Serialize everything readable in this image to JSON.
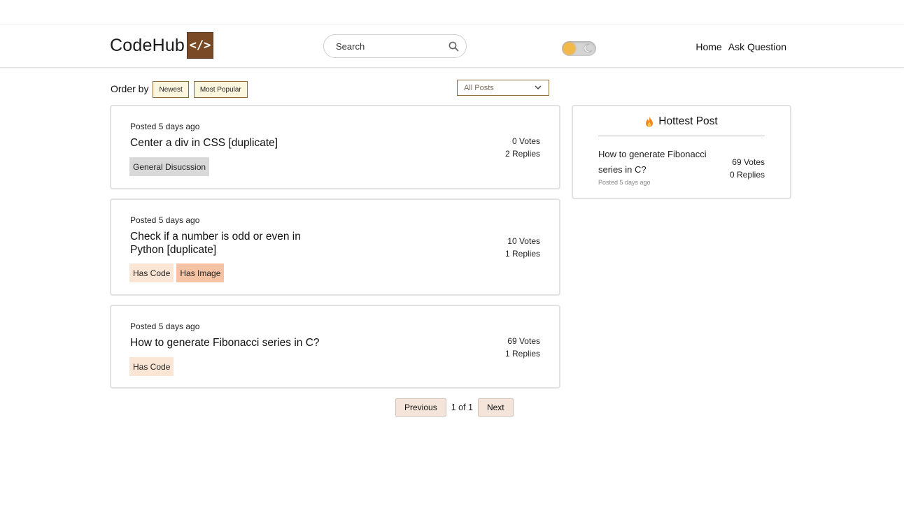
{
  "header": {
    "logo_text": "CodeHub",
    "logo_symbol": "</>",
    "search_placeholder": "Search",
    "nav": [
      "Home",
      "Ask Question"
    ],
    "accent": "#7a4a26"
  },
  "toolbar": {
    "order_label": "Order by",
    "order_options": [
      "Newest",
      "Most Popular"
    ],
    "filter_selected": "All Posts"
  },
  "posts": [
    {
      "posted": "Posted 5 days ago",
      "title": "Center a div in CSS [duplicate]",
      "votes": "0 Votes",
      "replies": "2 Replies",
      "tags": [
        "General Disucssion"
      ]
    },
    {
      "posted": "Posted 5 days ago",
      "title": "Check if a number is odd or even in Python [duplicate]",
      "votes": "10 Votes",
      "replies": "1 Replies",
      "tags": [
        "Has Code",
        "Has Image"
      ]
    },
    {
      "posted": "Posted 5 days ago",
      "title": "How to generate Fibonacci series in C?",
      "votes": "69 Votes",
      "replies": "1 Replies",
      "tags": [
        "Has Code"
      ]
    }
  ],
  "pagination": {
    "previous": "Previous",
    "info": "1 of 1",
    "next": "Next"
  },
  "hottest": {
    "heading": "Hottest Post",
    "title": "How to generate Fibonacci series in C?",
    "posted": "Posted 5 days ago",
    "votes": "69 Votes",
    "replies": "0 Replies"
  }
}
